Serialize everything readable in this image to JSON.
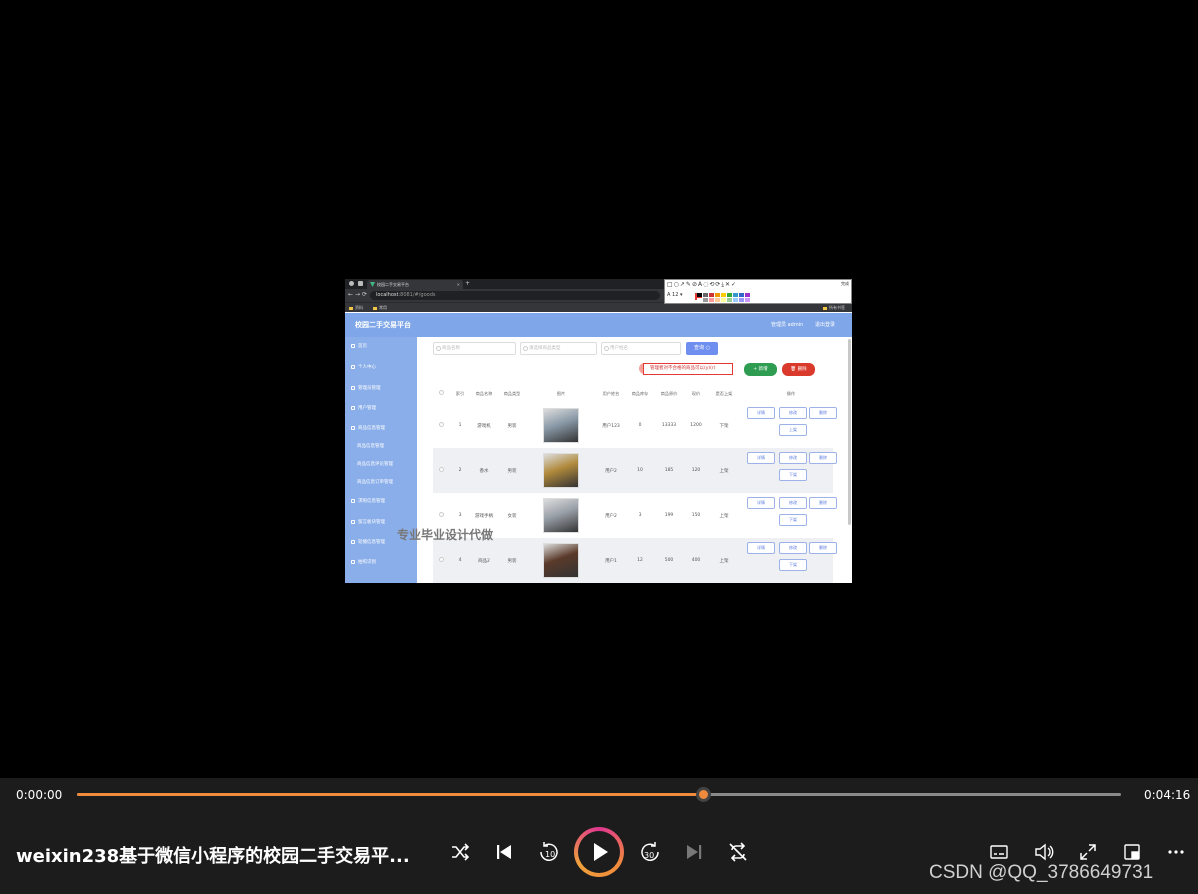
{
  "browser": {
    "tab_title": "校园二手交易平台",
    "url_host": "localhost",
    "url_rest": ":8081/#/goods",
    "bookmarks": [
      "资料",
      "常用"
    ],
    "bookmark_right": "所有书签"
  },
  "snip_tool": {
    "done_label": "完成",
    "font_size": "12"
  },
  "app": {
    "title": "校园二手交易平台",
    "admin_label": "管理员 admin",
    "logout_label": "退出登录"
  },
  "sidebar": {
    "items": [
      "首页",
      "个人中心",
      "管理员管理",
      "用户管理",
      "商品信息管理",
      "求购信息管理",
      "留言板块管理",
      "轮播信息管理",
      "拍照识别"
    ],
    "subitems": [
      "商品信息管理",
      "商品信息评论管理",
      "商品信息订单管理"
    ]
  },
  "filters": {
    "name_placeholder": "商品名称",
    "type_placeholder": "请选择商品类型",
    "user_placeholder": "用户姓名",
    "search_label": "查询"
  },
  "toolbar": {
    "tip": "管理者对不合格的商品可以(y)(r)",
    "add_label": "+ 新增",
    "delete_label": "删除"
  },
  "table": {
    "headers": [
      "索引",
      "商品名称",
      "商品类型",
      "图片",
      "用户姓名",
      "商品库存",
      "商品原价",
      "现价",
      "是否上架",
      "操作"
    ],
    "rows": [
      {
        "index": "1",
        "name": "游戏机",
        "type": "男装",
        "user": "用户123",
        "stock": "0",
        "orig": "13333",
        "price": "1200",
        "status": "下架",
        "toggle": "上架",
        "thumb_color": "#8a9aa8"
      },
      {
        "index": "2",
        "name": "香水",
        "type": "男装",
        "user": "用户2",
        "stock": "10",
        "orig": "185",
        "price": "120",
        "status": "上架",
        "toggle": "下架",
        "thumb_color": "#b08a3c"
      },
      {
        "index": "3",
        "name": "游戏手柄",
        "type": "女装",
        "user": "用户2",
        "stock": "3",
        "orig": "199",
        "price": "150",
        "status": "上架",
        "toggle": "下架",
        "thumb_color": "#9aa0a8"
      },
      {
        "index": "4",
        "name": "商品2",
        "type": "男装",
        "user": "用户1",
        "stock": "12",
        "orig": "500",
        "price": "400",
        "status": "上架",
        "toggle": "下架",
        "thumb_color": "#5a3a2a"
      }
    ],
    "op_detail": "详情",
    "op_edit": "修改",
    "op_delete": "删除"
  },
  "watermark": "专业毕业设计代做",
  "player": {
    "time_current": "0:00:00",
    "time_total": "0:04:16",
    "progress_fraction": 0.6,
    "title": "weixin238基于微信小程序的校园二手交易平...",
    "accent": "#f08a3c",
    "csdn_watermark": "CSDN @QQ_3786649731"
  }
}
